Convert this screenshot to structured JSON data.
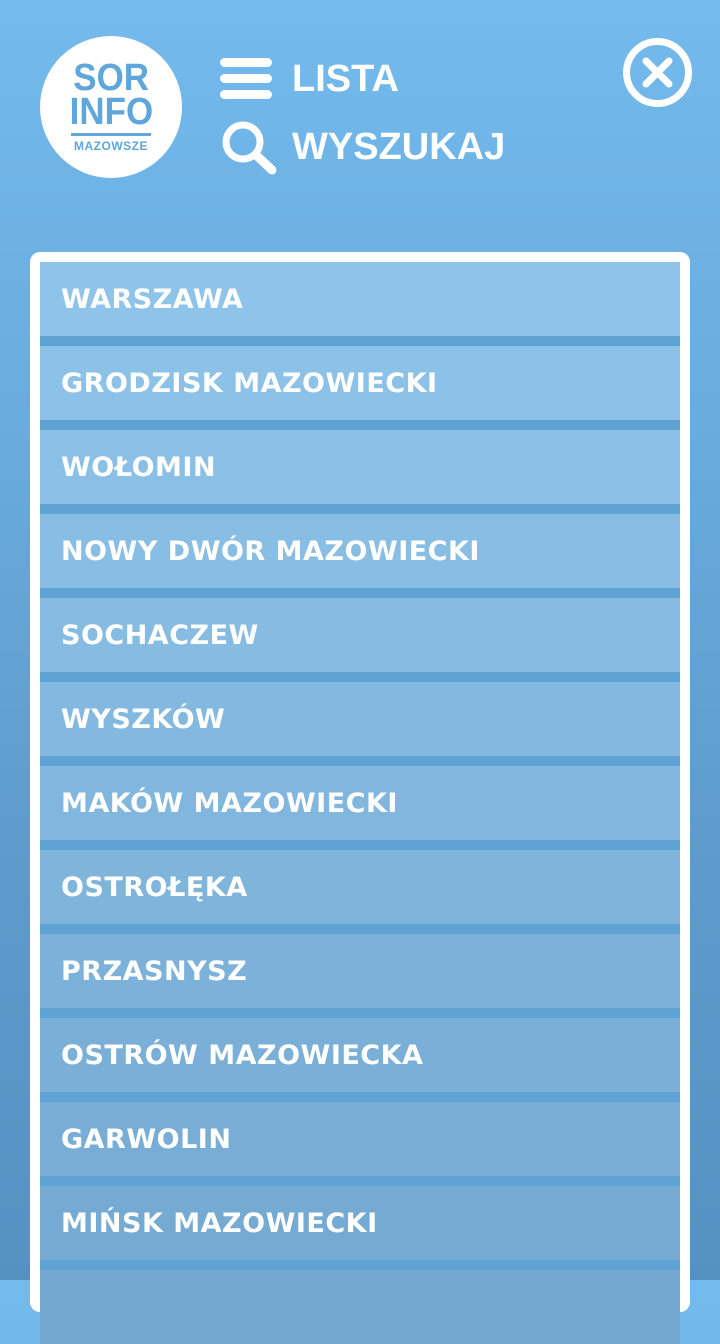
{
  "logo": {
    "line1": "SOR",
    "line2": "INFO",
    "subtitle": "MAZOWSZE"
  },
  "header": {
    "menu": [
      {
        "label": "LISTA",
        "icon": "hamburger-icon"
      },
      {
        "label": "WYSZUKAJ",
        "icon": "search-icon"
      }
    ],
    "close_icon": "close-icon"
  },
  "colors": {
    "background_top": "#74baec",
    "background_bottom": "#5591c1",
    "panel": "#ffffff",
    "list_separator": "#5fa3d5",
    "logo_text": "#5ea6dc"
  },
  "cities": [
    "WARSZAWA",
    "GRODZISK MAZOWIECKI",
    "WOŁOMIN",
    "NOWY DWÓR MAZOWIECKI",
    "SOCHACZEW",
    "WYSZKÓW",
    "MAKÓW MAZOWIECKI",
    "OSTROŁĘKA",
    "PRZASNYSZ",
    "OSTRÓW MAZOWIECKA",
    "GARWOLIN",
    "MIŃSK MAZOWIECKI",
    ""
  ]
}
